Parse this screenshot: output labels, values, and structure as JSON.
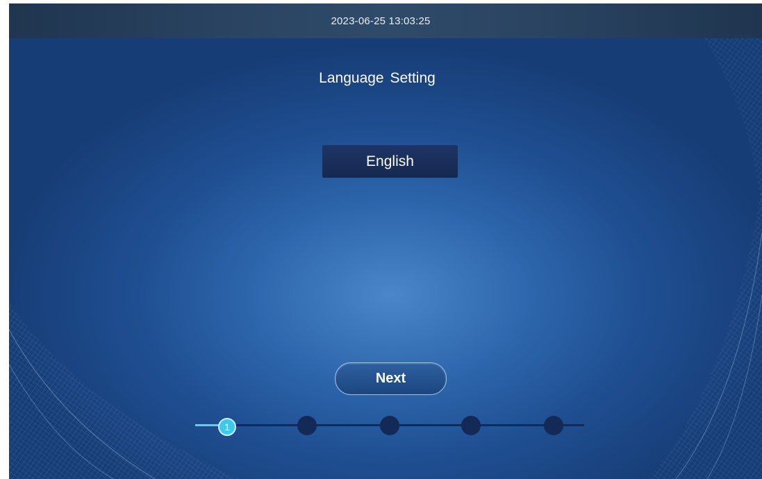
{
  "status_bar": {
    "datetime": "2023-06-25 13:03:25"
  },
  "page": {
    "title": "Language Setting"
  },
  "language_selector": {
    "selected": "English"
  },
  "actions": {
    "next_label": "Next"
  },
  "stepper": {
    "current_step": 1,
    "current_step_label": "1",
    "total_steps": 5
  },
  "colors": {
    "background_center": "#4a86c8",
    "background_edge": "#173d76",
    "status_bar": "#2a4461",
    "button_dark": "#1d3566",
    "step_active": "#3ec8ea",
    "step_inactive": "#122a55"
  }
}
